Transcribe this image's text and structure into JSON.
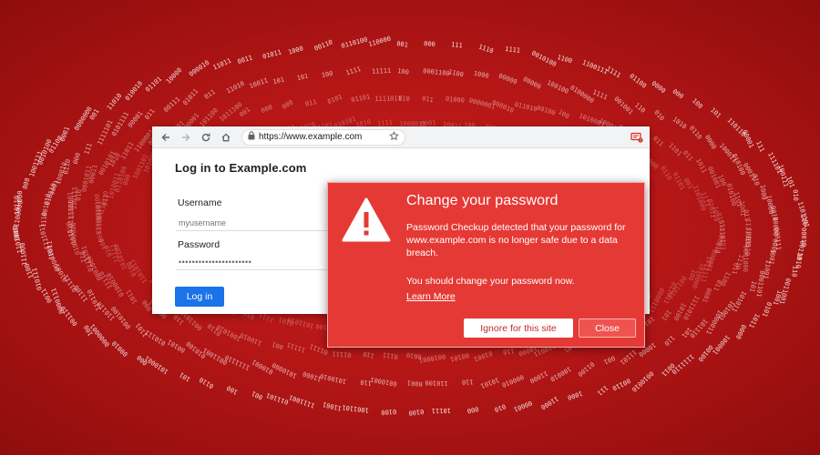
{
  "browser": {
    "url": "https://www.example.com",
    "icons": [
      "back-arrow-icon",
      "forward-arrow-icon",
      "reload-icon",
      "home-icon",
      "lock-icon",
      "star-icon",
      "extension-icon"
    ]
  },
  "login": {
    "title": "Log in to Example.com",
    "username_label": "Username",
    "username_placeholder": "myusername",
    "password_label": "Password",
    "password_value": "••••••••••••••••••••••",
    "button_label": "Log in"
  },
  "dialog": {
    "title": "Change your password",
    "body": "Password Checkup detected that your password for www.example.com is no longer safe due to a data breach.",
    "body2": "You should change your password now.",
    "learn_more": "Learn More",
    "ignore_label": "Ignore for this site",
    "close_label": "Close",
    "icon": "warning-triangle-icon"
  },
  "colors": {
    "background": "#b51616",
    "dialog": "#e53935",
    "login_button": "#1a73e8"
  }
}
